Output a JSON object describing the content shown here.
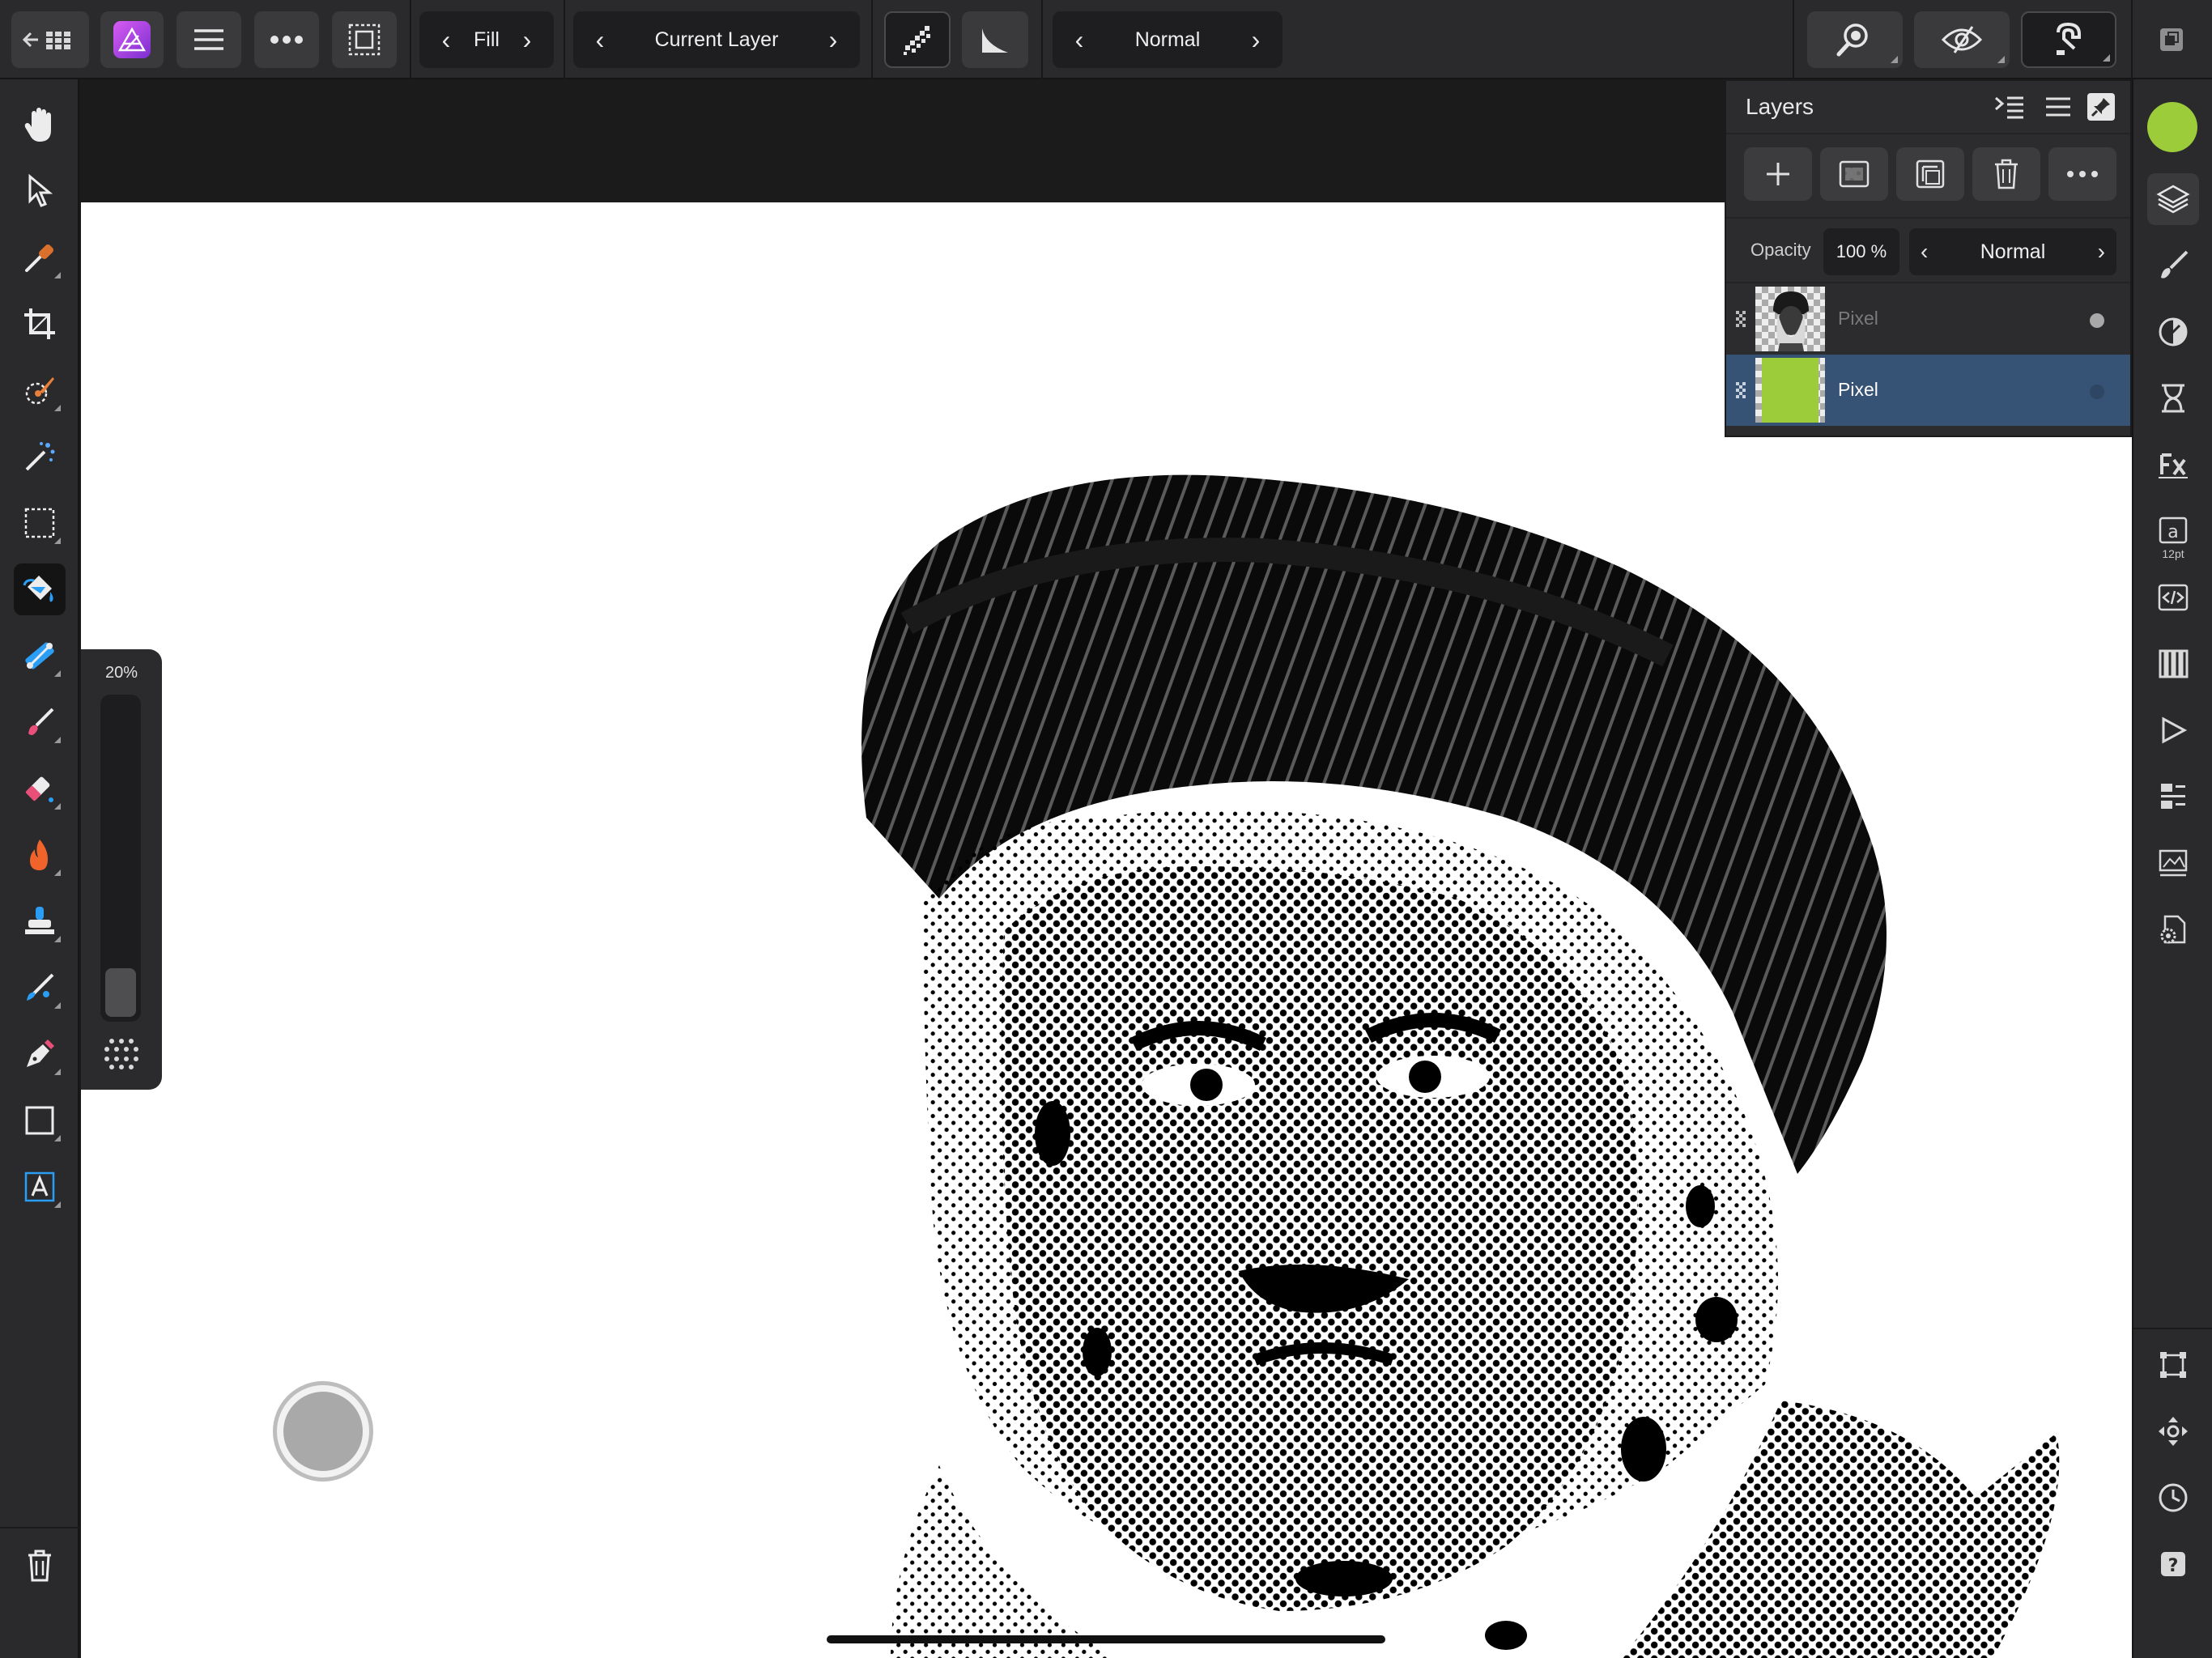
{
  "app": {
    "name": "Affinity Photo",
    "accent_color": "#b044e0",
    "selection_color": "#365274"
  },
  "toolbar": {
    "fill_mode": "Fill",
    "source": "Current Layer",
    "blend_mode": "Normal",
    "icons": [
      "back-arrow-icon",
      "grid-icon",
      "app-logo-icon",
      "menu-icon",
      "more-icon",
      "selection-icon",
      "dither-icon",
      "ramp-icon",
      "zoom-icon",
      "view-icon",
      "snapping-icon",
      "window-icon"
    ]
  },
  "left_tools": [
    {
      "name": "view-tool",
      "icon": "hand-icon"
    },
    {
      "name": "move-tool",
      "icon": "pointer-icon"
    },
    {
      "name": "color-picker-tool",
      "icon": "eyedropper-icon"
    },
    {
      "name": "crop-tool",
      "icon": "crop-icon"
    },
    {
      "name": "selection-brush-tool",
      "icon": "selection-brush-icon"
    },
    {
      "name": "flood-select-tool",
      "icon": "magic-wand-icon"
    },
    {
      "name": "marquee-tool",
      "icon": "marquee-icon"
    },
    {
      "name": "flood-fill-tool",
      "icon": "paint-bucket-icon",
      "active": true
    },
    {
      "name": "gradient-tool",
      "icon": "gradient-icon"
    },
    {
      "name": "paint-brush-tool",
      "icon": "brush-icon"
    },
    {
      "name": "erase-brush-tool",
      "icon": "eraser-icon"
    },
    {
      "name": "dodge-burn-tool",
      "icon": "flame-icon"
    },
    {
      "name": "clone-tool",
      "icon": "stamp-icon"
    },
    {
      "name": "healing-tool",
      "icon": "bandage-icon"
    },
    {
      "name": "pen-tool",
      "icon": "pen-icon"
    },
    {
      "name": "rectangle-tool",
      "icon": "rectangle-icon"
    },
    {
      "name": "text-tool",
      "icon": "text-icon"
    },
    {
      "name": "delete-tool",
      "icon": "trash-icon"
    }
  ],
  "brush_slider": {
    "value_label": "20%",
    "value": 0.2
  },
  "right_studio": {
    "current_color": "#9ccc3a",
    "icons": [
      "layers-icon",
      "brushes-icon",
      "adjustments-icon",
      "history-icon",
      "fx-icon",
      "character-icon",
      "macro-icon",
      "swatches-icon",
      "play-icon",
      "navigator-icon",
      "stock-icon",
      "settings-icon",
      "transform-icon",
      "move-icon",
      "clock-icon",
      "help-icon"
    ],
    "character_size": "12pt"
  },
  "layers_panel": {
    "title": "Layers",
    "opacity_label": "Opacity",
    "opacity_value": "100 %",
    "blend_mode": "Normal",
    "layers": [
      {
        "name": "Pixel",
        "selected": false,
        "thumb": "portrait"
      },
      {
        "name": "Pixel",
        "selected": true,
        "thumb": "green-fill",
        "fill_color": "#9ccc3a"
      }
    ]
  }
}
